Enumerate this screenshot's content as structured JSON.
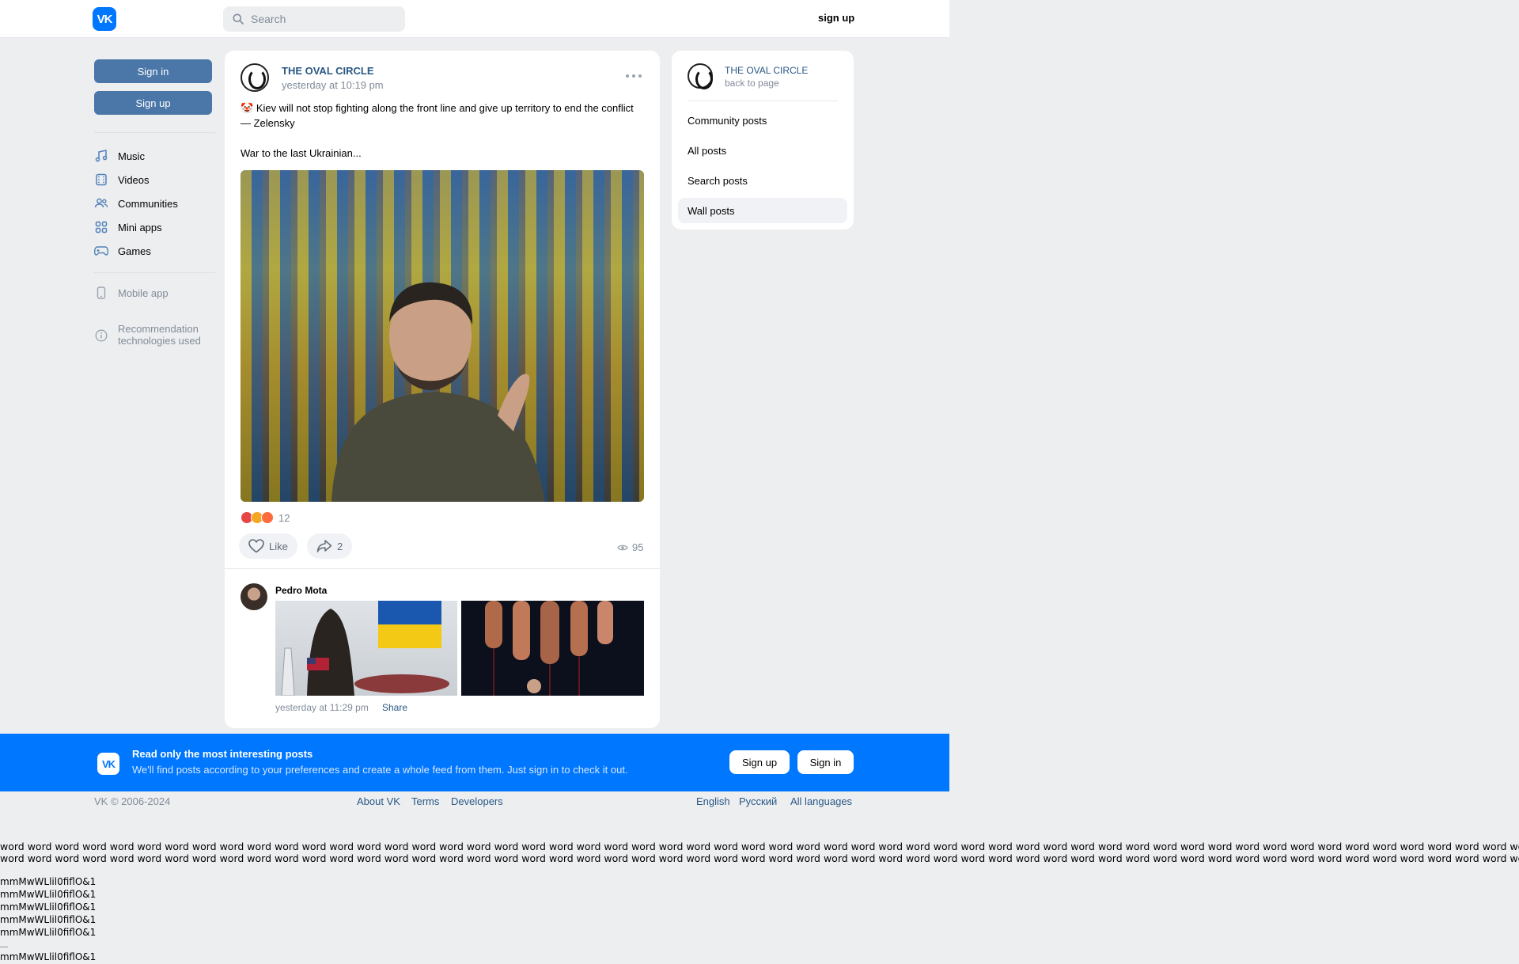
{
  "header": {
    "logo_text": "VK",
    "search_placeholder": "Search",
    "signup_label": "sign up"
  },
  "left_nav": {
    "sign_in_label": "Sign in",
    "sign_up_label": "Sign up",
    "items": [
      {
        "label": "Music",
        "icon": "music-note-icon"
      },
      {
        "label": "Videos",
        "icon": "video-film-icon"
      },
      {
        "label": "Communities",
        "icon": "users-icon"
      },
      {
        "label": "Mini apps",
        "icon": "grid-apps-icon"
      },
      {
        "label": "Games",
        "icon": "gamepad-icon"
      }
    ],
    "mobile_app_label": "Mobile app",
    "recommendation_label_1": "Recommendation",
    "recommendation_label_2": "technologies used"
  },
  "post": {
    "author": "THE OVAL CIRCLE",
    "time": "yesterday at 10:19 pm",
    "emoji": "🤡",
    "text_line1": "Kiev will not stop fighting along the front line and give up territory to end the conflict — Zelensky",
    "text_line2": "War to the last Ukrainian...",
    "reactions_count": "12",
    "reaction_colors": [
      "#e64646",
      "#f5a623",
      "#ff6a3d"
    ],
    "like_label": "Like",
    "share_count": "2",
    "views_count": "95"
  },
  "comment": {
    "author": "Pedro Mota",
    "time": "yesterday at 11:29 pm",
    "share_label": "Share"
  },
  "right_panel": {
    "community_name": "THE OVAL CIRCLE",
    "back_label": "back to page",
    "items": [
      {
        "label": "Community posts",
        "active": false
      },
      {
        "label": "All posts",
        "active": false
      },
      {
        "label": "Search posts",
        "active": false
      },
      {
        "label": "Wall posts",
        "active": true
      }
    ]
  },
  "banner": {
    "logo_text": "VK",
    "title": "Read only the most interesting posts",
    "subtitle": "We'll find posts according to your preferences and create a whole feed from them. Just sign in to check it out.",
    "sign_up_label": "Sign up",
    "sign_in_label": "Sign in"
  },
  "footer": {
    "copyright": "VK © 2006-2024",
    "about": "About VK",
    "terms": "Terms",
    "developers": "Developers",
    "lang_en": "English",
    "lang_ru": "Русский",
    "lang_all": "All languages"
  },
  "test_text": {
    "word_line": "word word word word word word word word word word word word word word word word word word word word word word word word word word word word word word word word word word word word word word word word word word word word word word word word word word word word word word word word word word word word word word word word word word word word word",
    "glyph_line": "mmMwWLlil0fiflO&1"
  },
  "colors": {
    "vk_blue": "#0077ff",
    "button_blue": "#4a76a8",
    "link_blue": "#2a5885",
    "background": "#edeef0"
  }
}
